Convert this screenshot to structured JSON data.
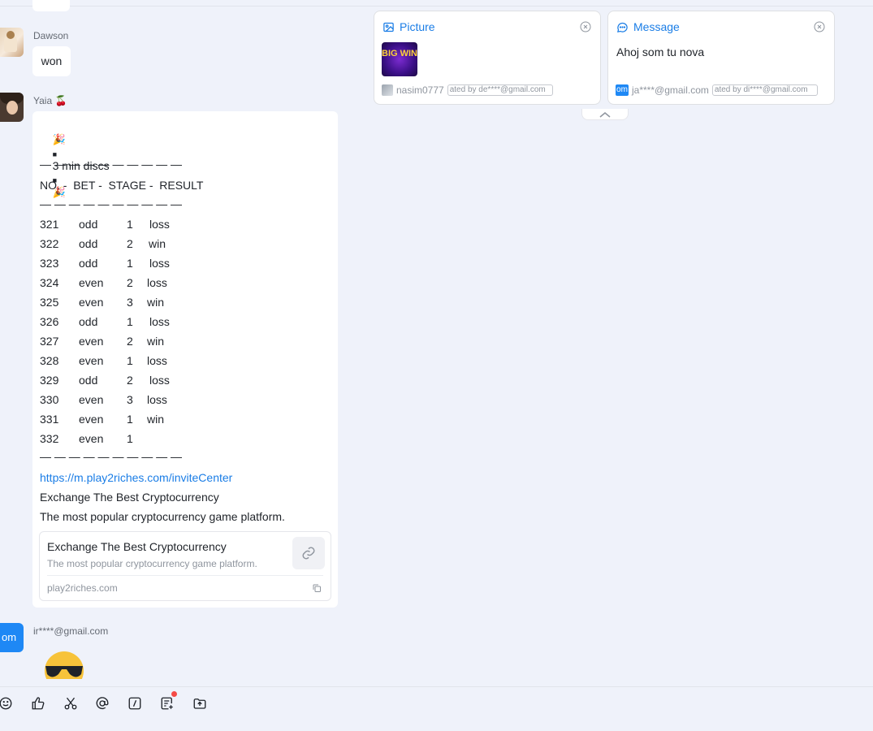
{
  "messages": [
    {
      "sender": "Dawson",
      "text": "won"
    },
    {
      "sender": "Yaia 🍒",
      "header": "3 min discs",
      "divider": "— — — — — — — — — —",
      "table_header": "NO. -  BET -  STAGE -  RESULT",
      "rows": [
        {
          "no": "321",
          "bet": "odd",
          "stage": "1",
          "result": "loss"
        },
        {
          "no": "322",
          "bet": "odd",
          "stage": "2",
          "result": "win"
        },
        {
          "no": "323",
          "bet": "odd",
          "stage": "1",
          "result": "loss"
        },
        {
          "no": "324",
          "bet": "even",
          "stage": "2",
          "result": "loss"
        },
        {
          "no": "325",
          "bet": "even",
          "stage": "3",
          "result": "win"
        },
        {
          "no": "326",
          "bet": "odd",
          "stage": "1",
          "result": "loss"
        },
        {
          "no": "327",
          "bet": "even",
          "stage": "2",
          "result": "win"
        },
        {
          "no": "328",
          "bet": "even",
          "stage": "1",
          "result": "loss"
        },
        {
          "no": "329",
          "bet": "odd",
          "stage": "2",
          "result": "loss"
        },
        {
          "no": "330",
          "bet": "even",
          "stage": "3",
          "result": "loss"
        },
        {
          "no": "331",
          "bet": "even",
          "stage": "1",
          "result": "win"
        },
        {
          "no": "332",
          "bet": "even",
          "stage": "1",
          "result": ""
        }
      ],
      "link": "https://m.play2riches.com/inviteCenter",
      "line1": "Exchange The Best Cryptocurrency",
      "line2": "The most popular cryptocurrency game platform.",
      "card": {
        "title": "Exchange The Best Cryptocurrency",
        "desc": "The most popular cryptocurrency game platform.",
        "domain": "play2riches.com"
      }
    },
    {
      "sender": "ir****@gmail.com",
      "avatar_text": "om"
    }
  ],
  "pinned": [
    {
      "type": "Picture",
      "image_text": "BIG WIN",
      "author": "nasim0777",
      "tag": "ated by de****@gmail.com"
    },
    {
      "type": "Message",
      "text": "Ahoj som tu nova",
      "avatar_text": "om",
      "author": "ja****@gmail.com",
      "tag": "ated by di****@gmail.com"
    }
  ],
  "toolbar": [
    "emoji-icon",
    "thumbs-up-icon",
    "scissors-icon",
    "mention-icon",
    "slash-command-icon",
    "task-icon",
    "upload-icon"
  ],
  "colors": {
    "accent": "#1a7de6",
    "background": "#eff2fa",
    "badge": "#f54a45"
  }
}
